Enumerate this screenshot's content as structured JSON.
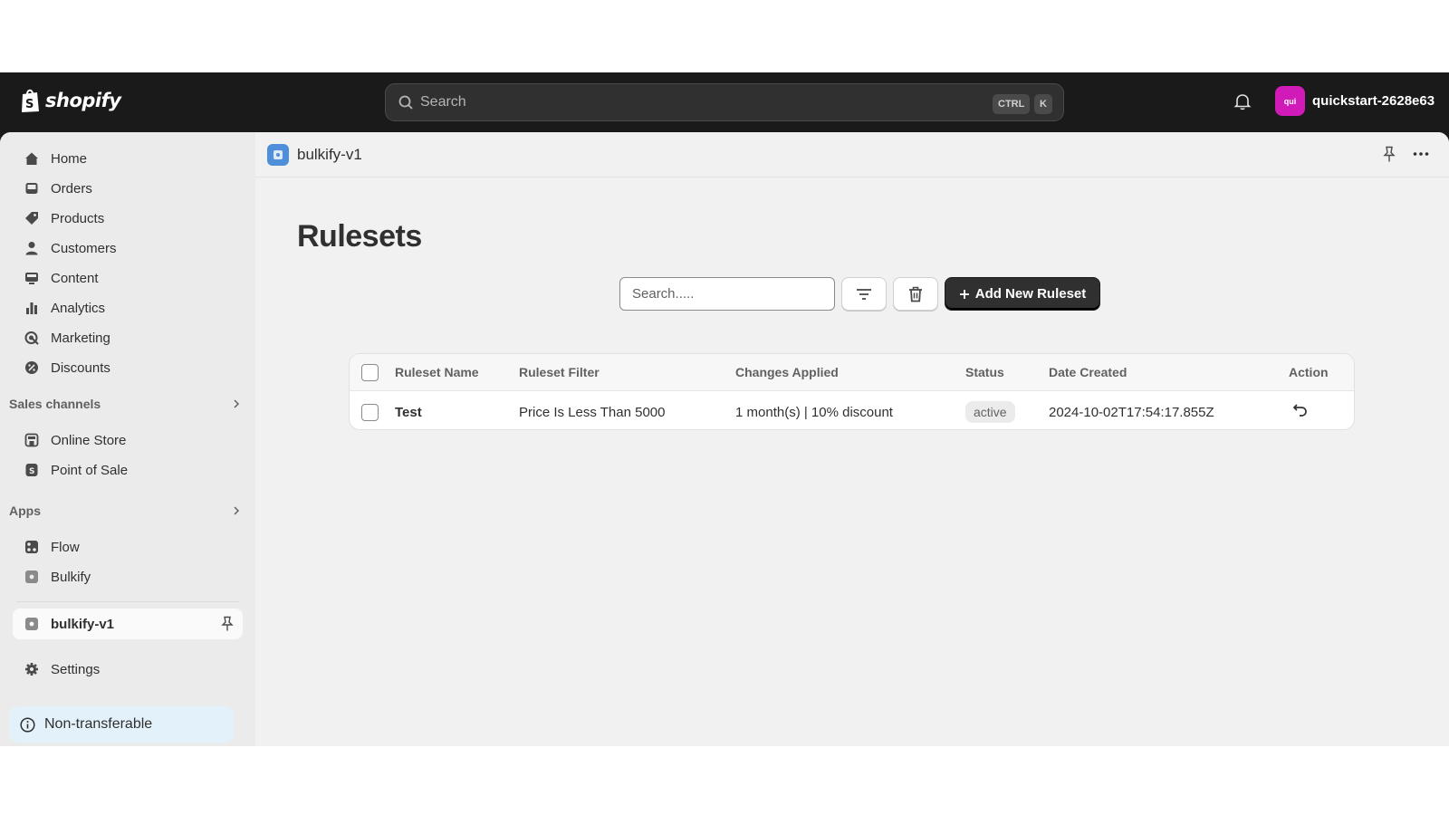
{
  "topbar": {
    "logo_text": "shopify",
    "search_placeholder": "Search",
    "kbd_ctrl": "CTRL",
    "kbd_k": "K",
    "avatar_text": "qui",
    "store_name": "quickstart-2628e63"
  },
  "sidebar": {
    "items": [
      {
        "label": "Home",
        "icon": "home-icon"
      },
      {
        "label": "Orders",
        "icon": "inbox-icon"
      },
      {
        "label": "Products",
        "icon": "tag-icon"
      },
      {
        "label": "Customers",
        "icon": "person-icon"
      },
      {
        "label": "Content",
        "icon": "content-icon"
      },
      {
        "label": "Analytics",
        "icon": "bar-chart-icon"
      },
      {
        "label": "Marketing",
        "icon": "target-icon"
      },
      {
        "label": "Discounts",
        "icon": "discount-icon"
      }
    ],
    "sales_channels_heading": "Sales channels",
    "sales_channels": [
      {
        "label": "Online Store",
        "icon": "store-icon"
      },
      {
        "label": "Point of Sale",
        "icon": "pos-icon"
      }
    ],
    "apps_heading": "Apps",
    "apps": [
      {
        "label": "Flow",
        "icon": "flow-icon"
      },
      {
        "label": "Bulkify",
        "icon": "app-icon"
      }
    ],
    "pinned_app": "bulkify-v1",
    "settings": "Settings",
    "banner": "Non-transferable"
  },
  "appbar": {
    "title": "bulkify-v1"
  },
  "page": {
    "title": "Rulesets",
    "search_placeholder": "Search.....",
    "add_button": "Add New Ruleset"
  },
  "table": {
    "columns": [
      "Ruleset Name",
      "Ruleset Filter",
      "Changes Applied",
      "Status",
      "Date Created",
      "Action"
    ],
    "rows": [
      {
        "name": "Test",
        "filter": "Price Is Less Than 5000",
        "changes": "1 month(s) | 10% discount",
        "status": "active",
        "date": "2024-10-02T17:54:17.855Z",
        "action_icon": "undo-icon"
      }
    ]
  },
  "colors": {
    "topbar_bg": "#1a1a1a",
    "avatar_bg": "#d01bb8",
    "primary_button": "#303030",
    "app_icon": "#4f8ed9",
    "banner_bg": "#e3f1fb"
  }
}
